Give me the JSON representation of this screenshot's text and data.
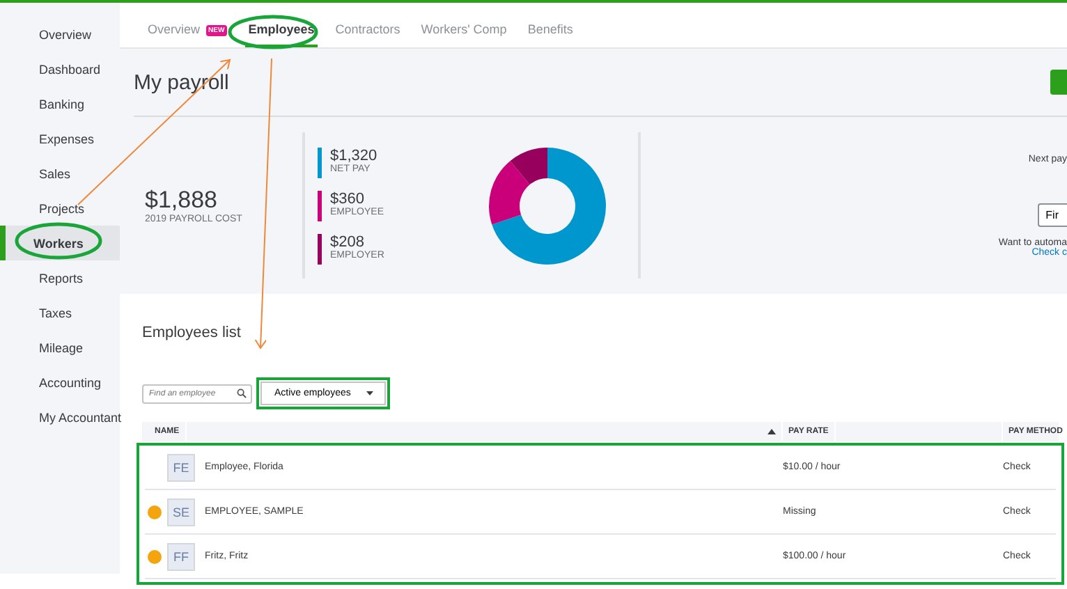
{
  "sidebar": {
    "items": [
      {
        "label": "Overview",
        "selected": false
      },
      {
        "label": "Dashboard",
        "selected": false
      },
      {
        "label": "Banking",
        "selected": false
      },
      {
        "label": "Expenses",
        "selected": false
      },
      {
        "label": "Sales",
        "selected": false
      },
      {
        "label": "Projects",
        "selected": false
      },
      {
        "label": "Workers",
        "selected": true
      },
      {
        "label": "Reports",
        "selected": false
      },
      {
        "label": "Taxes",
        "selected": false
      },
      {
        "label": "Mileage",
        "selected": false
      },
      {
        "label": "Accounting",
        "selected": false
      },
      {
        "label": "My Accountant",
        "selected": false
      }
    ]
  },
  "tabs": [
    {
      "label": "Overview",
      "badge": "NEW",
      "selected": false
    },
    {
      "label": "Employees",
      "selected": true
    },
    {
      "label": "Contractors",
      "selected": false
    },
    {
      "label": "Workers' Comp",
      "selected": false
    },
    {
      "label": "Benefits",
      "selected": false
    }
  ],
  "page_title": "My payroll",
  "summary": {
    "total": "$1,888",
    "total_label": "2019 PAYROLL COST",
    "legend": [
      {
        "amount": "$1,320",
        "label": "NET PAY",
        "color": "#0097cf"
      },
      {
        "amount": "$360",
        "label": "EMPLOYEE",
        "color": "#c9007a"
      },
      {
        "amount": "$208",
        "label": "EMPLOYER",
        "color": "#98005e"
      }
    ],
    "chart_data": {
      "type": "donut",
      "values": [
        69.9,
        19.1,
        11.0
      ]
    },
    "next_pay": "Next pay",
    "button": "Fir",
    "automate_text": "Want to automa",
    "link": "Check c"
  },
  "employees": {
    "title": "Employees list",
    "search": {
      "placeholder": "Find an employee"
    },
    "filter": "Active employees",
    "columns": [
      "NAME",
      "PAY RATE",
      "PAY METHOD"
    ],
    "rows": [
      {
        "warning": false,
        "initials": "FE",
        "name": "Employee, Florida",
        "pay_rate": "$10.00 / hour",
        "pay_method": "Check"
      },
      {
        "warning": true,
        "initials": "SE",
        "name": "EMPLOYEE, SAMPLE",
        "pay_rate": "Missing",
        "pay_method": "Check"
      },
      {
        "warning": true,
        "initials": "FF",
        "name": "Fritz, Fritz",
        "pay_rate": "$100.00 / hour",
        "pay_method": "Check"
      }
    ]
  }
}
